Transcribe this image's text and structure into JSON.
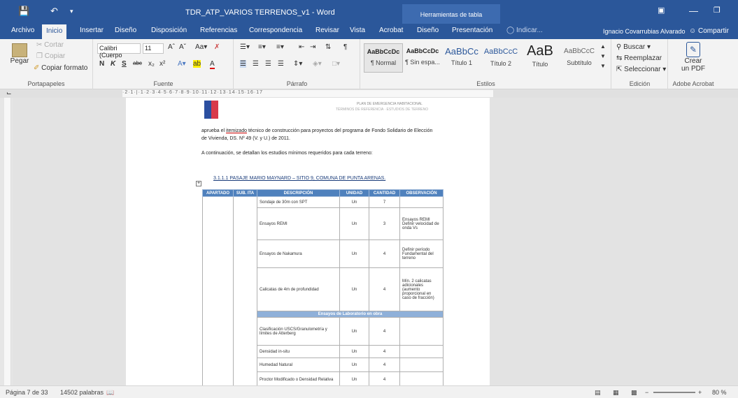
{
  "window": {
    "title": "TDR_ATP_VARIOS TERRENOS_v1 - Word",
    "context_group": "Herramientas de tabla",
    "user": "Ignacio Covarrubias Alvarado",
    "share_label": "Compartir"
  },
  "tabs": [
    "Archivo",
    "Inicio",
    "Insertar",
    "Diseño",
    "Disposición",
    "Referencias",
    "Correspondencia",
    "Revisar",
    "Vista",
    "Acrobat",
    "Diseño",
    "Presentación",
    "Indicar..."
  ],
  "active_tab": "Inicio",
  "ribbon": {
    "clipboard": {
      "paste": "Pegar",
      "cut": "Cortar",
      "copy": "Copiar",
      "format_painter": "Copiar formato",
      "label": "Portapapeles"
    },
    "font": {
      "font_name": "Calibri (Cuerpo",
      "font_size": "11",
      "bold": "N",
      "italic": "K",
      "underline": "S",
      "label": "Fuente"
    },
    "paragraph": {
      "label": "Párrafo"
    },
    "styles": {
      "items": [
        {
          "preview": "AaBbCcDc",
          "name": "¶ Normal"
        },
        {
          "preview": "AaBbCcDc",
          "name": "¶ Sin espa..."
        },
        {
          "preview": "AaBbCc",
          "name": "Título 1"
        },
        {
          "preview": "AaBbCcC",
          "name": "Título 2"
        },
        {
          "preview": "AaB",
          "name": "Título"
        },
        {
          "preview": "AaBbCcC",
          "name": "Subtítulo"
        }
      ],
      "label": "Estilos"
    },
    "editing": {
      "find": "Buscar",
      "replace": "Reemplazar",
      "select": "Seleccionar",
      "label": "Edición"
    },
    "acrobat": {
      "create_pdf_1": "Crear",
      "create_pdf_2": "un PDF",
      "label": "Adobe Acrobat"
    }
  },
  "ruler": "·2·1·|·1·2·3·4·5·6·7·8·9·10·11·12·13·14·15·16·17",
  "document": {
    "header_line1": "PLAN DE EMERGENCIA HABITACIONAL",
    "header_line2": "TÉRMINOS DE REFERENCIA · ESTUDIOS DE TERRENO",
    "para1_a": "aprueba el ",
    "para1_word": "itemizado",
    "para1_b": " técnico de construcción para proyectos del programa de Fondo Solidario de Elección",
    "para1_line2": "de Vivienda, DS. Nº 49 (V. y U.) de 2011.",
    "para2": "A continuación, se detallan los estudios mínimos requeridos para cada terreno:",
    "heading": "3.1.1.1  PASAJE MARIO MAYNARD – SITIO 9, COMUNA DE PUNTA ARENAS."
  },
  "table": {
    "headers": [
      "APARTADO",
      "SUB. ITA",
      "DESCRIPCIÓN",
      "UNIDAD",
      "CANTIDAD",
      "OBSERVACIÓN"
    ],
    "rows": [
      {
        "desc": "Sondaje de 30m con SPT",
        "unit": "Un",
        "qty": "7",
        "obs": ""
      },
      {
        "desc": "Ensayos REMI",
        "unit": "Un",
        "qty": "3",
        "obs": "Ensayos REMI Definir velocidad de onda Vs"
      },
      {
        "desc": "Ensayos de Nakamura",
        "unit": "Un",
        "qty": "4",
        "obs": "Definir período Fundamental del terreno"
      },
      {
        "desc": "Calicatas de 4m de profundidad",
        "unit": "Un",
        "qty": "4",
        "obs": "Mín. 2 calicatas adicionales (aumento proporcional en caso de fracción)"
      }
    ],
    "band": "Ensayos de Laboratorio en obra",
    "rows2": [
      {
        "desc": "Clasificación USCS/Granulometría y límites de Atterberg",
        "unit": "Un",
        "qty": "4",
        "obs": ""
      },
      {
        "desc": "Densidad in-situ",
        "unit": "Un",
        "qty": "4",
        "obs": ""
      },
      {
        "desc": "Humedad Natural",
        "unit": "Un",
        "qty": "4",
        "obs": ""
      },
      {
        "desc": "Proctor Modificado o Densidad Relativa",
        "unit": "Un",
        "qty": "4",
        "obs": ""
      }
    ]
  },
  "status": {
    "page": "Página 7 de 33",
    "words": "14502 palabras",
    "zoom": "80 %"
  },
  "colors": {
    "word_blue": "#2b579a",
    "table_header": "#4f81bd",
    "table_band": "#8fb0d9"
  }
}
